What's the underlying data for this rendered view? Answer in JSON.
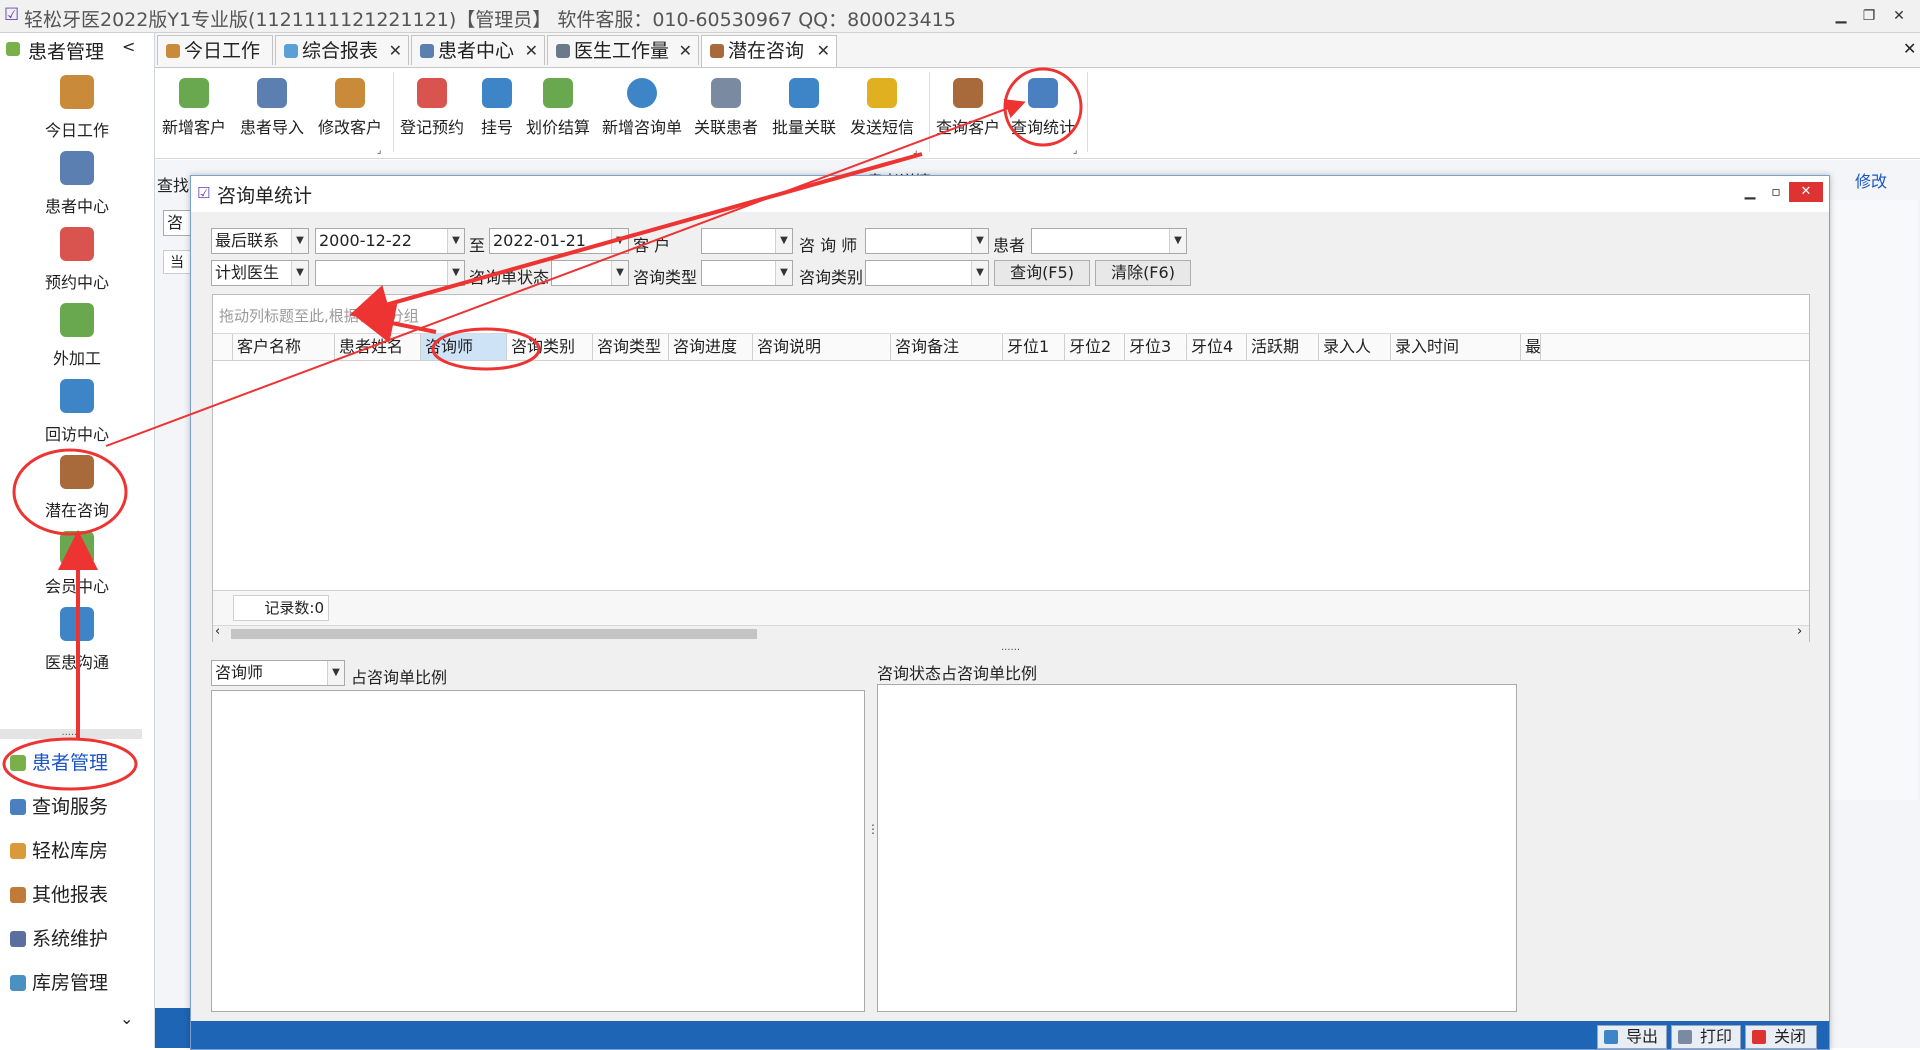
{
  "window": {
    "title": "轻松牙医2022版Y1专业版(1121111121221121)【管理员】   软件客服：010-60530967 QQ：800023415",
    "min": "▁",
    "restore": "❐",
    "close": "✕",
    "close_all_tabs": "✕"
  },
  "left_nav": {
    "header": "患者管理",
    "collapse": "<",
    "items": [
      {
        "label": "今日工作",
        "color": "#c98a3a"
      },
      {
        "label": "患者中心",
        "color": "#5a7fb0"
      },
      {
        "label": "预约中心",
        "color": "#d9534f"
      },
      {
        "label": "外加工",
        "color": "#6aa84f"
      },
      {
        "label": "回访中心",
        "color": "#3d85c6"
      },
      {
        "label": "潜在咨询",
        "color": "#a86a3a"
      },
      {
        "label": "会员中心",
        "color": "#6aa84f"
      },
      {
        "label": "医患沟通",
        "color": "#3d85c6"
      }
    ],
    "splitter": "......",
    "bottom": [
      {
        "label": "患者管理",
        "color": "#7ab04a"
      },
      {
        "label": "查询服务",
        "color": "#4a7fc0"
      },
      {
        "label": "轻松库房",
        "color": "#d99a3a"
      },
      {
        "label": "其他报表",
        "color": "#c07a3a"
      },
      {
        "label": "系统维护",
        "color": "#5a6fa0"
      },
      {
        "label": "库房管理",
        "color": "#4a90c0"
      }
    ],
    "more": "⌄"
  },
  "tabs": [
    {
      "label": "今日工作",
      "closable": false
    },
    {
      "label": "综合报表",
      "closable": true
    },
    {
      "label": "患者中心",
      "closable": true
    },
    {
      "label": "医生工作量",
      "closable": true
    },
    {
      "label": "潜在咨询",
      "closable": true
    }
  ],
  "ribbon": {
    "group1": [
      "新增客户",
      "患者导入",
      "修改客户"
    ],
    "group2": [
      "登记预约",
      "挂号",
      "划价结算",
      "新增咨询单",
      "关联患者",
      "批量关联",
      "发送短信"
    ],
    "group3": [
      "查询客户",
      "查询统计"
    ],
    "launcher": "⌟"
  },
  "background": {
    "search_label": "查找",
    "detail_label": "患者详情",
    "edit_link": "修改",
    "partial_input": "咨",
    "partial_col": "当"
  },
  "dialog": {
    "title": "咨询单统计",
    "filters": {
      "last_contact_label": "最后联系",
      "date_from": "2000-12-22",
      "to_label": "至",
      "date_to": "2022-01-21",
      "customer_label": "客  户",
      "consultant_label": "咨 询 师",
      "patient_label": "患者",
      "plan_doctor_label": "计划医生",
      "status_label": "咨询单状态",
      "type_label": "咨询类型",
      "category_label": "咨询类别",
      "query_btn": "查询(F5)",
      "clear_btn": "清除(F6)"
    },
    "grid": {
      "group_hint": "拖动列标题至此,根据该列分组",
      "columns": [
        "客户名称",
        "患者姓名",
        "咨询师",
        "咨询类别",
        "咨询类型",
        "咨询进度",
        "咨询说明",
        "咨询备注",
        "牙位1",
        "牙位2",
        "牙位3",
        "牙位4",
        "活跃期",
        "录入人",
        "录入时间",
        "最"
      ],
      "record_count": "记录数:0"
    },
    "splitter": "......",
    "chart_left": {
      "selector": "咨询师",
      "label": "占咨询单比例"
    },
    "chart_right": {
      "label": "咨询状态占咨询单比例"
    },
    "buttons": {
      "export": "导出",
      "print": "打印",
      "close": "关闭"
    }
  },
  "annotations": {
    "color": "#ee3333"
  }
}
